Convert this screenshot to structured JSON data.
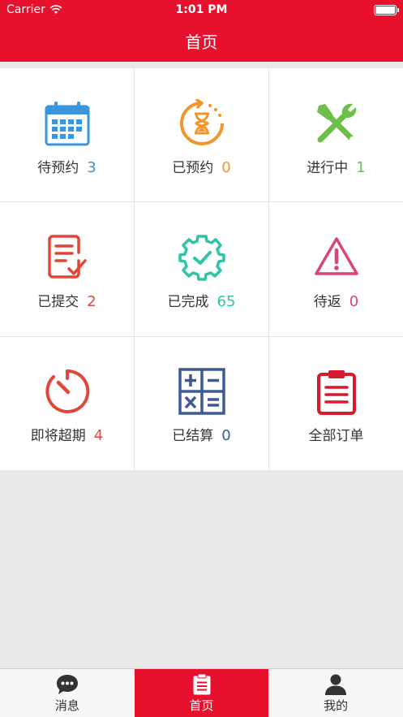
{
  "status": {
    "carrier": "Carrier",
    "time": "1:01 PM"
  },
  "header": {
    "title": "首页"
  },
  "colors": {
    "brand": "#e8112d"
  },
  "cards": [
    {
      "label": "待预约",
      "count": "3",
      "color": "#3a95dd",
      "icon": "calendar-icon"
    },
    {
      "label": "已预约",
      "count": "0",
      "color": "#f0962a",
      "icon": "hourglass-icon"
    },
    {
      "label": "进行中",
      "count": "1",
      "color": "#6cc04a",
      "icon": "tools-icon"
    },
    {
      "label": "已提交",
      "count": "2",
      "color": "#e0463a",
      "icon": "document-check-icon"
    },
    {
      "label": "已完成",
      "count": "65",
      "color": "#2ec4a5",
      "icon": "gear-check-icon"
    },
    {
      "label": "待返",
      "count": "0",
      "color": "#d9447a",
      "icon": "warning-icon"
    },
    {
      "label": "即将超期",
      "count": "4",
      "color": "#e0463a",
      "icon": "timer-icon"
    },
    {
      "label": "已结算",
      "count": "0",
      "color": "#3c5b94",
      "icon": "calculator-icon"
    },
    {
      "label": "全部订单",
      "count": "",
      "color": "#d9192d",
      "icon": "clipboard-icon"
    }
  ],
  "tabs": [
    {
      "label": "消息",
      "icon": "message-icon"
    },
    {
      "label": "首页",
      "icon": "home-clipboard-icon"
    },
    {
      "label": "我的",
      "icon": "user-icon"
    }
  ]
}
